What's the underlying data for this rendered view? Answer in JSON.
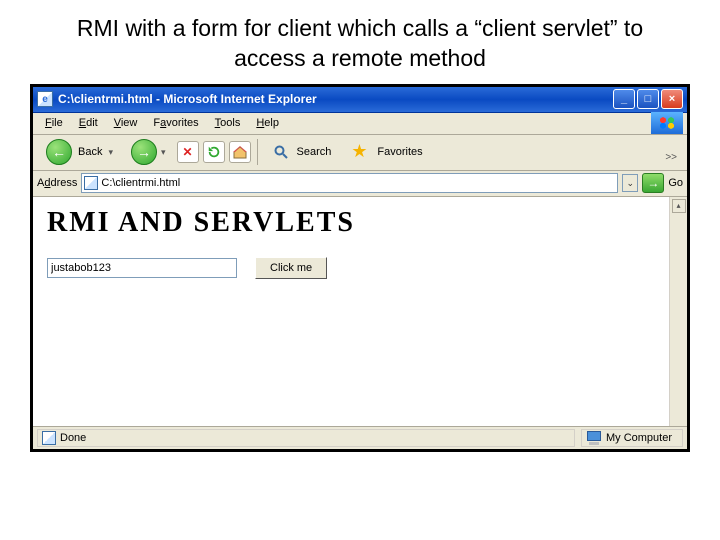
{
  "slide": {
    "title": "RMI with a form for client which calls a “client servlet” to access a remote method"
  },
  "titlebar": {
    "text": "C:\\clientrmi.html - Microsoft Internet Explorer"
  },
  "menu": {
    "file": "File",
    "edit": "Edit",
    "view": "View",
    "favorites": "Favorites",
    "tools": "Tools",
    "help": "Help"
  },
  "toolbar": {
    "back": "Back",
    "search": "Search",
    "favorites": "Favorites",
    "overflow": ">>"
  },
  "address": {
    "label": "Address",
    "value": "C:\\clientrmi.html",
    "go": "Go"
  },
  "page": {
    "heading": "RMI AND SERVLETS",
    "input_value": "justabob123",
    "button_label": "Click me"
  },
  "status": {
    "left": "Done",
    "zone": "My Computer"
  }
}
